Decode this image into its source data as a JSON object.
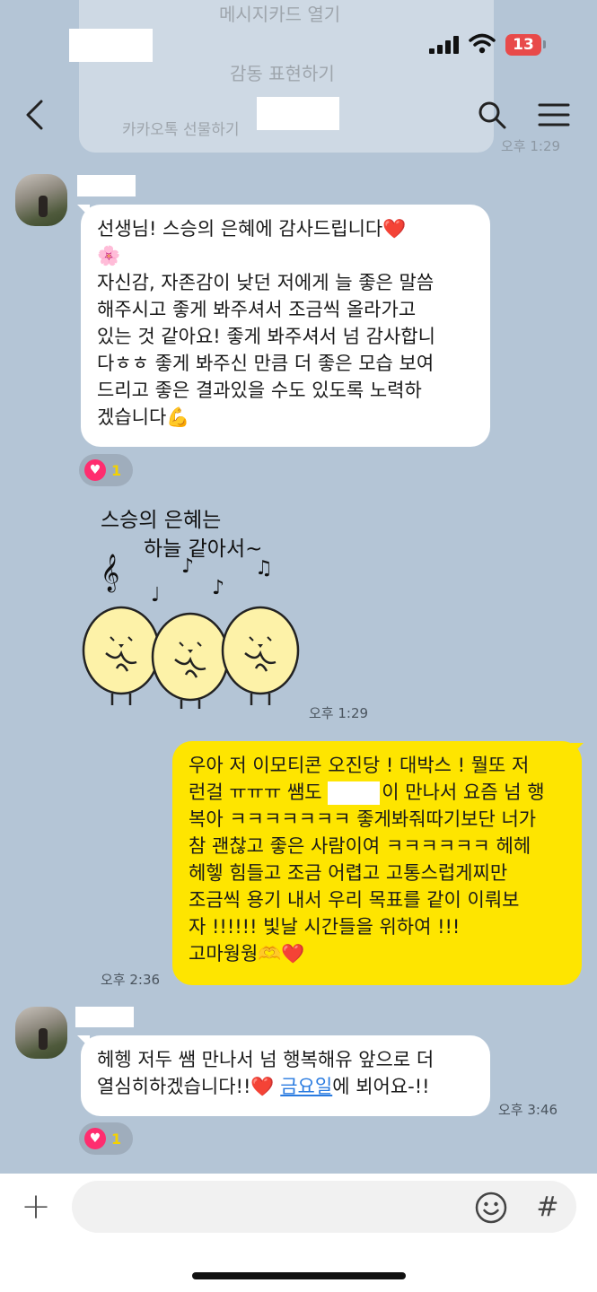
{
  "ghost_popup": {
    "item1": "메시지카드 열기",
    "item2": "감동 표현하기",
    "item3": "카카오톡 선물하기",
    "time": "오후 1:29"
  },
  "status_bar": {
    "battery": "13"
  },
  "header": {
    "icons": [
      "back-arrow-icon",
      "search-icon",
      "menu-icon"
    ]
  },
  "messages": [
    {
      "side": "left",
      "text": "선생님! 스승의 은혜에 감사드립니다❤️\n🌸\n자신감, 자존감이 낮던 저에게 늘 좋은 말씀\n해주시고 좋게 봐주셔서 조금씩 올라가고\n있는 것 같아요! 좋게 봐주셔서 넘 감사합니\n다ㅎㅎ 좋게 봐주신 만큼 더 좋은 모습 보여\n드리고 좋은 결과있을 수도 있도록 노력하\n겠습니다💪",
      "reaction_count": "1"
    },
    {
      "side": "left",
      "type": "sticker",
      "sticker_line1": "스승의 은혜는",
      "sticker_line2": "하늘 같아서~",
      "time": "오후 1:29"
    },
    {
      "side": "right",
      "text_part1": "우아 저 이모티콘 오진당 ! 대박스 ! 뭘또 저\n런걸 ㅠㅠㅠ 쌤도 ",
      "text_part2": "이 만나서 요즘 넘 행\n복아 ㅋㅋㅋㅋㅋㅋㅋ 좋게봐줘따기보단 너가\n참 괜찮고 좋은 사람이여 ㅋㅋㅋㅋㅋㅋ 헤헤\n헤헿 힘들고 조금 어렵고 고통스럽게찌만\n조금씩 용기 내서 우리 목표를 같이 이뤄보\n자 !!!!!! 빛날 시간들을 위하여 !!!\n고마웡웡🫶❤️",
      "time": "오후 2:36"
    },
    {
      "side": "left",
      "text_part1": "헤헹 저두 쌤 만나서 넘 행복해유 앞으로 더\n열심히하겠습니다!!❤️ ",
      "link": "금요일",
      "text_part2": "에 뵈어요-!!",
      "time": "오후 3:46",
      "reaction_count": "1"
    }
  ],
  "input_bar": {
    "add_symbol": "+",
    "hash_symbol": "#",
    "icons": [
      "plus-icon",
      "emoji-icon",
      "hash-icon"
    ]
  }
}
